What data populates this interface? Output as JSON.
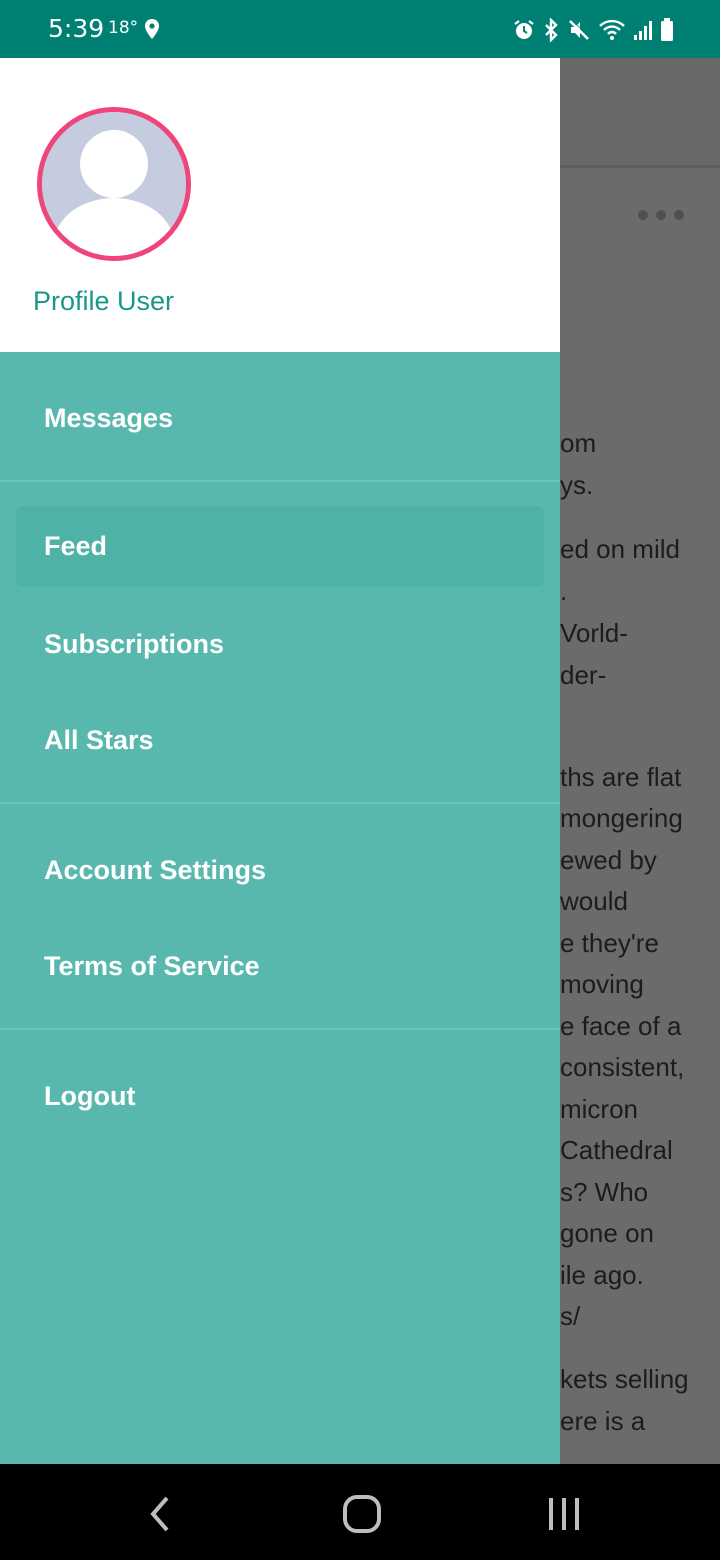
{
  "status_bar": {
    "time": "5:39",
    "temperature": "18°",
    "icons": [
      "location-icon",
      "alarm-icon",
      "bluetooth-icon",
      "mute-icon",
      "wifi-icon",
      "signal-icon",
      "battery-icon"
    ],
    "background_color": "#008072"
  },
  "drawer": {
    "profile": {
      "name": "Profile User",
      "avatar_ring_color": "#f0457a"
    },
    "background_color": "#59b8ae",
    "items": [
      {
        "label": "Messages",
        "active": false
      },
      {
        "label": "Feed",
        "active": true
      },
      {
        "label": "Subscriptions",
        "active": false
      },
      {
        "label": "All Stars",
        "active": false
      },
      {
        "label": "Account Settings",
        "active": false
      },
      {
        "label": "Terms of Service",
        "active": false
      },
      {
        "label": "Logout",
        "active": false
      }
    ]
  },
  "background_content": {
    "lines": [
      "om",
      "ys.",
      "ed on mild",
      ".",
      "Vorld-",
      "der-",
      "ths are flat",
      "mongering",
      "ewed by",
      " would",
      "e they're",
      "moving",
      "e face of a",
      "consistent,",
      "micron",
      "Cathedral",
      "s? Who",
      "gone on",
      "ile ago.",
      "s/",
      "kets selling",
      "ere is a"
    ]
  },
  "nav_bar": {
    "buttons": [
      "back-icon",
      "home-icon",
      "recents-icon"
    ]
  }
}
